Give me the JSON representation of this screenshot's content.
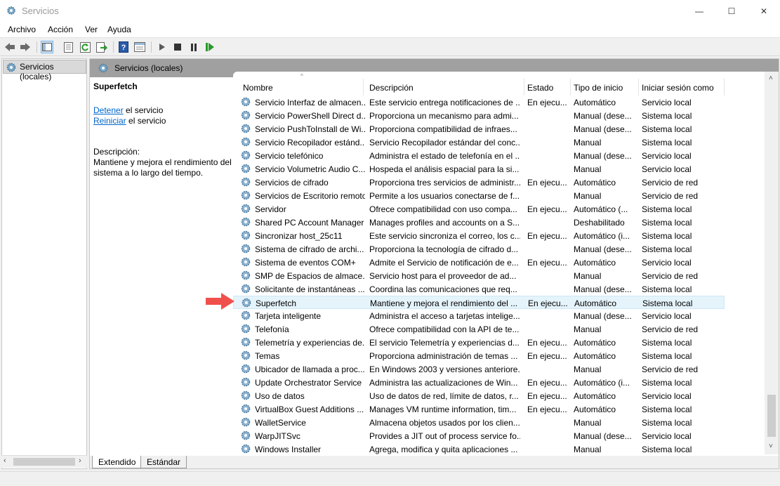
{
  "window": {
    "title": "Servicios",
    "minimize": "—",
    "maximize": "☐",
    "close": "✕"
  },
  "menu": [
    "Archivo",
    "Acción",
    "Ver",
    "Ayuda"
  ],
  "tree": {
    "root": "Servicios (locales)"
  },
  "main": {
    "header": "Servicios (locales)"
  },
  "detail": {
    "name": "Superfetch",
    "stop_link": "Detener",
    "stop_rest": " el servicio",
    "restart_link": "Reiniciar",
    "restart_rest": " el servicio",
    "desc_label": "Descripción:",
    "desc_text": "Mantiene y mejora el rendimiento del sistema a lo largo del tiempo."
  },
  "columns": [
    "Nombre",
    "Descripción",
    "Estado",
    "Tipo de inicio",
    "Iniciar sesión como"
  ],
  "rows": [
    [
      "Servicio Interfaz de almacen...",
      "Este servicio entrega notificaciones de ...",
      "En ejecu...",
      "Automático",
      "Servicio local"
    ],
    [
      "Servicio PowerShell Direct d...",
      "Proporciona un mecanismo para admi...",
      "",
      "Manual (dese...",
      "Sistema local"
    ],
    [
      "Servicio PushToInstall de Wi...",
      "Proporciona compatibilidad de infraes...",
      "",
      "Manual (dese...",
      "Sistema local"
    ],
    [
      "Servicio Recopilador estánd...",
      "Servicio Recopilador estándar del conc...",
      "",
      "Manual",
      "Sistema local"
    ],
    [
      "Servicio telefónico",
      "Administra el estado de telefonía en el ...",
      "",
      "Manual (dese...",
      "Servicio local"
    ],
    [
      "Servicio Volumetric Audio C...",
      "Hospeda el análisis espacial para la si...",
      "",
      "Manual",
      "Servicio local"
    ],
    [
      "Servicios de cifrado",
      "Proporciona tres servicios de administr...",
      "En ejecu...",
      "Automático",
      "Servicio de red"
    ],
    [
      "Servicios de Escritorio remoto",
      "Permite a los usuarios conectarse de f...",
      "",
      "Manual",
      "Servicio de red"
    ],
    [
      "Servidor",
      "Ofrece compatibilidad con uso compa...",
      "En ejecu...",
      "Automático (...",
      "Sistema local"
    ],
    [
      "Shared PC Account Manager",
      "Manages profiles and accounts on a S...",
      "",
      "Deshabilitado",
      "Sistema local"
    ],
    [
      "Sincronizar host_25c11",
      "Este servicio sincroniza el correo, los c...",
      "En ejecu...",
      "Automático (i...",
      "Sistema local"
    ],
    [
      "Sistema de cifrado de archi...",
      "Proporciona la tecnología de cifrado d...",
      "",
      "Manual (dese...",
      "Sistema local"
    ],
    [
      "Sistema de eventos COM+",
      "Admite el Servicio de notificación de e...",
      "En ejecu...",
      "Automático",
      "Servicio local"
    ],
    [
      "SMP de Espacios de almace...",
      "Servicio host para el proveedor de ad...",
      "",
      "Manual",
      "Servicio de red"
    ],
    [
      "Solicitante de instantáneas ...",
      "Coordina las comunicaciones que req...",
      "",
      "Manual (dese...",
      "Sistema local"
    ],
    [
      "Superfetch",
      "Mantiene y mejora el rendimiento del ...",
      "En ejecu...",
      "Automático",
      "Sistema local"
    ],
    [
      "Tarjeta inteligente",
      "Administra el acceso a tarjetas intelige...",
      "",
      "Manual (dese...",
      "Servicio local"
    ],
    [
      "Telefonía",
      "Ofrece compatibilidad con la API de te...",
      "",
      "Manual",
      "Servicio de red"
    ],
    [
      "Telemetría y experiencias de...",
      "El servicio Telemetría y experiencias d...",
      "En ejecu...",
      "Automático",
      "Sistema local"
    ],
    [
      "Temas",
      "Proporciona administración de temas ...",
      "En ejecu...",
      "Automático",
      "Sistema local"
    ],
    [
      "Ubicador de llamada a proc...",
      "En Windows 2003 y versiones anteriore...",
      "",
      "Manual",
      "Servicio de red"
    ],
    [
      "Update Orchestrator Service",
      "Administra las actualizaciones de Win...",
      "En ejecu...",
      "Automático (i...",
      "Sistema local"
    ],
    [
      "Uso de datos",
      "Uso de datos de red, límite de datos, r...",
      "En ejecu...",
      "Automático",
      "Servicio local"
    ],
    [
      "VirtualBox Guest Additions ...",
      "Manages VM runtime information, tim...",
      "En ejecu...",
      "Automático",
      "Sistema local"
    ],
    [
      "WalletService",
      "Almacena objetos usados por los clien...",
      "",
      "Manual",
      "Sistema local"
    ],
    [
      "WarpJITSvc",
      "Provides a JIT out of process service fo...",
      "",
      "Manual (dese...",
      "Servicio local"
    ],
    [
      "Windows Installer",
      "Agrega, modifica y quita aplicaciones ...",
      "",
      "Manual",
      "Sistema local"
    ]
  ],
  "selected_row": "Superfetch",
  "tabs": [
    "Extendido",
    "Estándar"
  ],
  "active_tab": "Extendido",
  "toolbar_icons": [
    "back-icon",
    "forward-icon",
    "show-tree-icon",
    "properties-icon",
    "refresh-icon",
    "export-icon",
    "help-icon",
    "details-icon",
    "start-icon",
    "stop-icon",
    "pause-icon",
    "restart-icon"
  ],
  "colors": {
    "accent_arrow": "#f0504c",
    "selection": "#e5f3fb",
    "link": "#0066cc"
  }
}
